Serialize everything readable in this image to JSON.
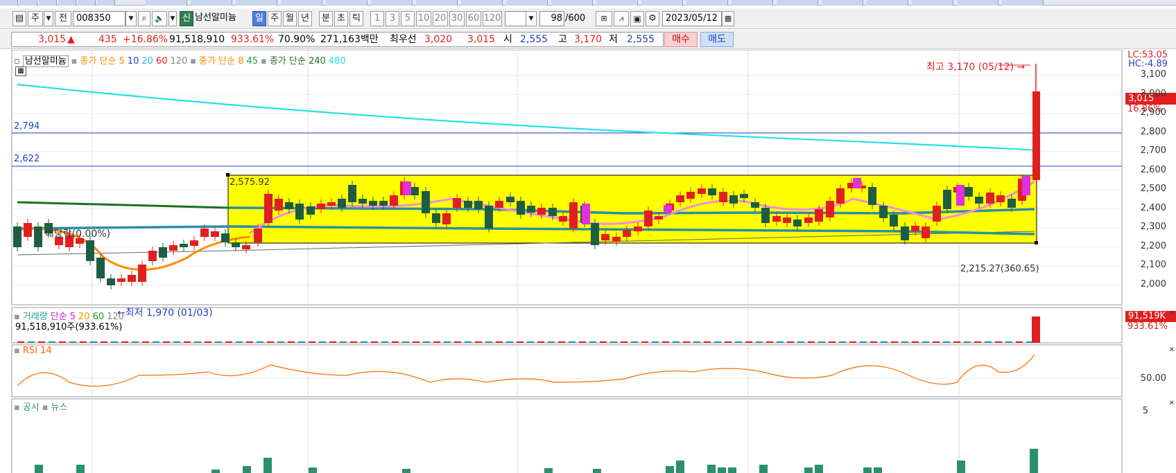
{
  "toolbar": {
    "week_label": "주",
    "all_label": "전",
    "code": "008350",
    "badge_new": "신",
    "stock_name": "남선알미늄",
    "periods": [
      "일",
      "주",
      "월",
      "년",
      "분",
      "초",
      "틱"
    ],
    "minutes": [
      "1",
      "3",
      "5",
      "10",
      "20",
      "30",
      "60",
      "120"
    ],
    "count": "98",
    "count_max": "/600",
    "date": "2023/05/12"
  },
  "quote": {
    "price": "3,015",
    "arrow": "▲",
    "change": "435",
    "change_pct": "+16.86%",
    "volume": "91,518,910",
    "volume_pct": "933.61%",
    "ratio": "70.90%",
    "amount": "271,163백만",
    "best_bid_label": "최우선",
    "best_bid": "3,020",
    "best_ask": "3,015",
    "open_label": "시",
    "open": "2,555",
    "high_label": "고",
    "high": "3,170",
    "low_label": "저",
    "low": "2,555",
    "buy_label": "매수",
    "sell_label": "매도"
  },
  "price_panel": {
    "legend": [
      {
        "text": "남선알미늄",
        "color": "#000000"
      },
      {
        "text": "종가 단순 5",
        "color": "#ff8c00"
      },
      {
        "text": "10",
        "color": "#1f3fbf"
      },
      {
        "text": "20",
        "color": "#2fb6e6"
      },
      {
        "text": "60",
        "color": "#e0201f"
      },
      {
        "text": "120",
        "color": "#888888"
      },
      {
        "text": "종가 단순 8",
        "color": "#ff8c00"
      },
      {
        "text": "45",
        "color": "#20a030"
      },
      {
        "text": "종가 단순 240",
        "color": "#1d6f1d"
      },
      {
        "text": "480",
        "color": "#25e0e8"
      }
    ],
    "lc": "LC:53.05",
    "hc": "HC:-4.89",
    "current_price": "3,015",
    "current_pct": "16.86%",
    "high_note": "최고 3,170 (05/12) →",
    "low_note": "←최저 1,970 (01/03)",
    "dividend_note": "배당락(0.00%)",
    "box_top_label": "2,575.92",
    "box_bottom_label": "2,215.27(360.65)",
    "hline1": "2,794",
    "hline2": "2,622",
    "yticks": [
      "3,100",
      "3,000",
      "2,900",
      "2,800",
      "2,700",
      "2,600",
      "2,500",
      "2,400",
      "2,300",
      "2,200",
      "2,100",
      "2,000"
    ]
  },
  "volume_panel": {
    "legend_name": "거래량",
    "legend_ma": "단순 5",
    "legend_periods": [
      "20",
      "60",
      "120"
    ],
    "value_text": "91,518,910주(933.61%)",
    "current": "91,519K",
    "current_pct": "933.61%"
  },
  "rsi_panel": {
    "legend": "RSI 14",
    "tick": "50.00"
  },
  "news_panel": {
    "legend_disclosure": "공시",
    "legend_news": "뉴스",
    "tick": "5"
  },
  "colors": {
    "up": "#e0201f",
    "down": "#1d5e43",
    "box_fill": "#ffff00",
    "ma240": "#1d6f1d",
    "ma480": "#25e0e8"
  }
}
